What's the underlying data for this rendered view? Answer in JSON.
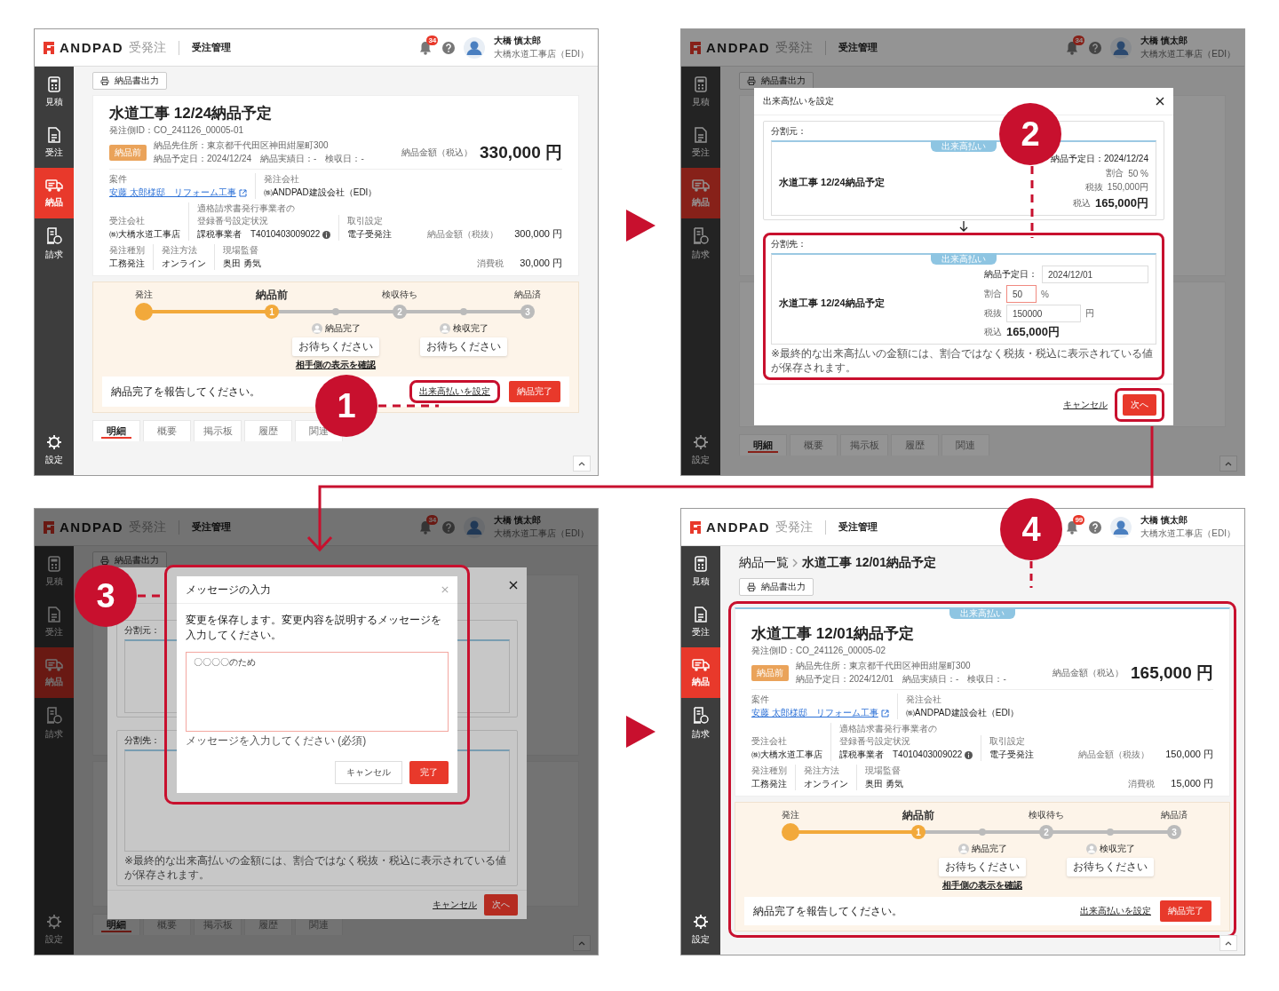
{
  "panels": [
    {
      "callout": "1",
      "header": {
        "logo": "ANDPAD",
        "product": "受発注",
        "section": "受注管理",
        "notifications": "34",
        "user_name": "大橋 慎太郎",
        "user_company": "大橋水道工事店（EDI）"
      },
      "sidebar": [
        {
          "label": "見積",
          "kind": "calculator",
          "selected": false
        },
        {
          "label": "受注",
          "kind": "document",
          "selected": false
        },
        {
          "label": "納品",
          "kind": "truck",
          "selected": true
        },
        {
          "label": "請求",
          "kind": "invoice",
          "selected": false
        },
        {
          "label": "設定",
          "kind": "gear",
          "selected": false
        }
      ],
      "main": {
        "print_button": "納品書出力",
        "card": {
          "title": "水道工事 12/24納品予定",
          "order_id": "発注側ID：CO_241126_00005-01",
          "status": "納品前",
          "address": "納品先住所：東京都千代田区神田紺屋町300",
          "dates": "納品予定日：2024/12/24　納品実績日：-　検収日：-",
          "total_label": "納品金額（税込）",
          "total": "330,000 円",
          "field_rows": [
            {
              "fields": [
                {
                  "label": "案件",
                  "value": "安藤 太郎様邸　リフォーム工事",
                  "kind": "link"
                },
                {
                  "label": "発注会社",
                  "value": "㈱ANDPAD建設会社（EDI）",
                  "kind": "text"
                }
              ]
            },
            {
              "fields": [
                {
                  "label": "受注会社",
                  "value": "㈱大橋水道工事店",
                  "kind": "text"
                },
                {
                  "label": "適格請求書発行事業者の登録番号設定状況",
                  "value": "課税事業者　T4010403009022",
                  "kind": "info"
                },
                {
                  "label": "取引設定",
                  "value": "電子受発注",
                  "kind": "text"
                }
              ],
              "amount": {
                "label": "納品金額（税抜）",
                "value": "300,000 円"
              }
            },
            {
              "fields": [
                {
                  "label": "発注種別",
                  "value": "工務発注",
                  "kind": "text"
                },
                {
                  "label": "発注方法",
                  "value": "オンライン",
                  "kind": "text"
                },
                {
                  "label": "現場監督",
                  "value": "奥田 勇気",
                  "kind": "text"
                }
              ],
              "amount": {
                "label": "消費税",
                "value": "30,000 円"
              }
            }
          ]
        },
        "progress": {
          "nodes": [
            {
              "kind": "step",
              "label": "発注",
              "reached": true,
              "current": false
            },
            {
              "kind": "step",
              "label": "納品前",
              "number": "1",
              "reached": true,
              "current": true
            },
            {
              "kind": "sub",
              "label": "納品完了",
              "note": "お待ちください"
            },
            {
              "kind": "step",
              "label": "検収待ち",
              "number": "2",
              "reached": false,
              "current": false
            },
            {
              "kind": "sub",
              "label": "検収完了",
              "note": "お待ちください"
            },
            {
              "kind": "step",
              "label": "納品済",
              "number": "3",
              "reached": false,
              "current": false
            }
          ],
          "link": "相手側の表示を確認",
          "message": "納品完了を報告してください。",
          "action_link": {
            "label": "出来高払いを設定",
            "highlighted": true
          },
          "button": "納品完了"
        },
        "tabs": [
          {
            "label": "明細",
            "selected": true
          },
          {
            "label": "概要",
            "selected": false
          },
          {
            "label": "掲示板",
            "selected": false
          },
          {
            "label": "履歴",
            "selected": false
          },
          {
            "label": "関連",
            "selected": false
          }
        ]
      }
    },
    {
      "callout": "2",
      "header": {
        "logo": "ANDPAD",
        "product": "受発注",
        "section": "受注管理",
        "notifications": "34",
        "user_name": "大橋 慎太郎",
        "user_company": "大橋水道工事店（EDI）"
      },
      "sidebar": [
        {
          "label": "見積",
          "kind": "calculator",
          "selected": false
        },
        {
          "label": "受注",
          "kind": "document",
          "selected": false
        },
        {
          "label": "納品",
          "kind": "truck",
          "selected": true
        },
        {
          "label": "請求",
          "kind": "invoice",
          "selected": false
        },
        {
          "label": "設定",
          "kind": "gear",
          "selected": false
        }
      ],
      "main": {
        "print_button": "納品書出力",
        "tabs": [
          {
            "label": "明細",
            "selected": true
          },
          {
            "label": "概要",
            "selected": false
          },
          {
            "label": "掲示板",
            "selected": false
          },
          {
            "label": "履歴",
            "selected": false
          },
          {
            "label": "関連",
            "selected": false
          }
        ]
      },
      "modals": [
        {
          "kind": "split",
          "title": "出来高払いを設定",
          "source": {
            "label": "分割元：",
            "card": {
              "ribbon": "出来高払い",
              "title": "水道工事 12/24納品予定",
              "date": "納品予定日：2024/12/24",
              "ratio_label": "割合",
              "ratio": "50 %",
              "excl_label": "税抜",
              "excl": "150,000円",
              "incl_label": "税込",
              "incl": "165,000円"
            }
          },
          "target": {
            "label": "分割先：",
            "highlighted": true,
            "card": {
              "ribbon": "出来高払い",
              "title": "水道工事 12/24納品予定",
              "date_label": "納品予定日：",
              "date": "2024/12/01",
              "ratio_label": "割合",
              "ratio": "50",
              "ratio_focused": true,
              "ratio_unit": "%",
              "excl_label": "税抜",
              "excl": "150000",
              "excl_unit": "円",
              "incl_label": "税込",
              "incl": "165,000円"
            },
            "note": "※最終的な出来高払いの金額には、割合ではなく税抜・税込に表示されている値が保存されます。"
          },
          "cancel": "キャンセル",
          "next": {
            "label": "次へ",
            "highlighted": true
          }
        }
      ]
    },
    {
      "callout": "3",
      "header": {
        "logo": "ANDPAD",
        "product": "受発注",
        "section": "受注管理",
        "notifications": "34",
        "user_name": "大橋 慎太郎",
        "user_company": "大橋水道工事店（EDI）"
      },
      "sidebar": [
        {
          "label": "見積",
          "kind": "calculator",
          "selected": false
        },
        {
          "label": "受注",
          "kind": "document",
          "selected": false
        },
        {
          "label": "納品",
          "kind": "truck",
          "selected": true
        },
        {
          "label": "請求",
          "kind": "invoice",
          "selected": false
        },
        {
          "label": "設定",
          "kind": "gear",
          "selected": false
        }
      ],
      "main": {
        "print_button": "納品書出力",
        "tabs": [
          {
            "label": "明細",
            "selected": true
          },
          {
            "label": "概要",
            "selected": false
          },
          {
            "label": "掲示板",
            "selected": false
          },
          {
            "label": "履歴",
            "selected": false
          },
          {
            "label": "関連",
            "selected": false
          }
        ]
      },
      "modals": [
        {
          "kind": "split",
          "source": {
            "label": "分割元："
          },
          "target": {
            "label": "分割先：",
            "highlighted": false,
            "note": "※最終的な出来高払いの金額には、割合ではなく税抜・税込に表示されている値が保存されます。"
          },
          "cancel": "キャンセル",
          "next": {
            "label": "次へ",
            "highlighted": false
          }
        },
        {
          "kind": "message",
          "highlighted": true,
          "title": "メッセージの入力",
          "text": "変更を保存します。変更内容を説明するメッセージを入力してください。",
          "message": "〇〇〇〇のため",
          "hint": "メッセージを入力してください (必須)",
          "cancel": "キャンセル",
          "confirm": "完了"
        }
      ]
    },
    {
      "callout": "4",
      "header": {
        "logo": "ANDPAD",
        "product": "受発注",
        "section": "受注管理",
        "notifications": "99",
        "user_name": "大橋 慎太郎",
        "user_company": "大橋水道工事店（EDI）"
      },
      "sidebar": [
        {
          "label": "見積",
          "kind": "calculator",
          "selected": false
        },
        {
          "label": "受注",
          "kind": "document",
          "selected": false
        },
        {
          "label": "納品",
          "kind": "truck",
          "selected": true
        },
        {
          "label": "請求",
          "kind": "invoice",
          "selected": false
        },
        {
          "label": "設定",
          "kind": "gear",
          "selected": false
        }
      ],
      "main": {
        "breadcrumb": [
          {
            "label": "納品一覧",
            "kind": "link"
          },
          {
            "label": "水道工事 12/01納品予定",
            "kind": "current"
          }
        ],
        "print_button": "納品書出力",
        "highlighted": true,
        "card": {
          "ribbon": "出来高払い",
          "title": "水道工事 12/01納品予定",
          "order_id": "発注側ID：CO_241126_00005-02",
          "status": "納品前",
          "address": "納品先住所：東京都千代田区神田紺屋町300",
          "dates": "納品予定日：2024/12/01　納品実績日：-　検収日：-",
          "total_label": "納品金額（税込）",
          "total": "165,000 円",
          "field_rows": [
            {
              "fields": [
                {
                  "label": "案件",
                  "value": "安藤 太郎様邸　リフォーム工事",
                  "kind": "link"
                },
                {
                  "label": "発注会社",
                  "value": "㈱ANDPAD建設会社（EDI）",
                  "kind": "text"
                }
              ]
            },
            {
              "fields": [
                {
                  "label": "受注会社",
                  "value": "㈱大橋水道工事店",
                  "kind": "text"
                },
                {
                  "label": "適格請求書発行事業者の登録番号設定状況",
                  "value": "課税事業者　T4010403009022",
                  "kind": "info"
                },
                {
                  "label": "取引設定",
                  "value": "電子受発注",
                  "kind": "text"
                }
              ],
              "amount": {
                "label": "納品金額（税抜）",
                "value": "150,000 円"
              }
            },
            {
              "fields": [
                {
                  "label": "発注種別",
                  "value": "工務発注",
                  "kind": "text"
                },
                {
                  "label": "発注方法",
                  "value": "オンライン",
                  "kind": "text"
                },
                {
                  "label": "現場監督",
                  "value": "奥田 勇気",
                  "kind": "text"
                }
              ],
              "amount": {
                "label": "消費税",
                "value": "15,000 円"
              }
            }
          ]
        },
        "progress": {
          "nodes": [
            {
              "kind": "step",
              "label": "発注",
              "reached": true,
              "current": false
            },
            {
              "kind": "step",
              "label": "納品前",
              "number": "1",
              "reached": true,
              "current": true
            },
            {
              "kind": "sub",
              "label": "納品完了",
              "note": "お待ちください"
            },
            {
              "kind": "step",
              "label": "検収待ち",
              "number": "2",
              "reached": false,
              "current": false
            },
            {
              "kind": "sub",
              "label": "検収完了",
              "note": "お待ちください"
            },
            {
              "kind": "step",
              "label": "納品済",
              "number": "3",
              "reached": false,
              "current": false
            }
          ],
          "link": "相手側の表示を確認",
          "message": "納品完了を報告してください。",
          "action_link": {
            "label": "出来高払いを設定",
            "highlighted": false
          },
          "button": "納品完了"
        }
      }
    }
  ]
}
